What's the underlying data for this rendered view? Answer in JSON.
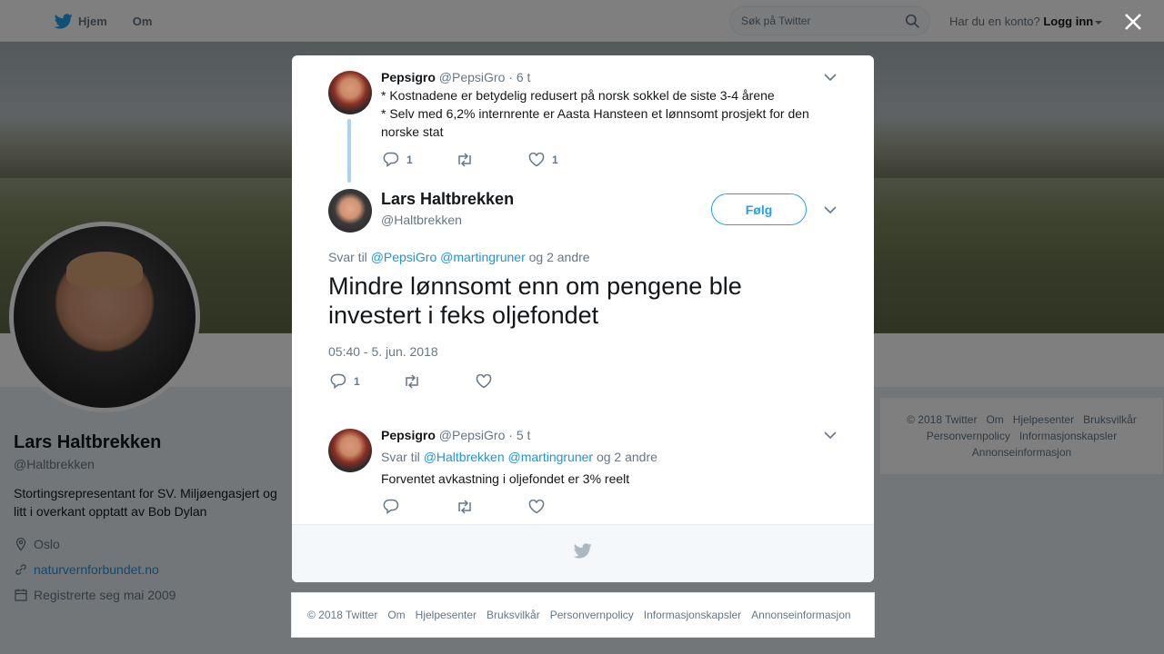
{
  "topbar": {
    "home_label": "Hjem",
    "about_label": "Om",
    "search_placeholder": "Søk på Twitter",
    "account_prompt": "Har du en konto?",
    "login_label": "Logg inn"
  },
  "profile": {
    "name": "Lars Haltbrekken",
    "handle": "@Haltbrekken",
    "bio": "Stortingsrepresentant for SV. Miljøengasjert og litt i overkant opptatt av Bob Dylan",
    "location": "Oslo",
    "website": "naturvernforbundet.no",
    "joined": "Registrerte seg mai 2009"
  },
  "side_footer": [
    "© 2018 Twitter",
    "Om",
    "Hjelpesenter",
    "Bruksvilkår",
    "Personvernpolicy",
    "Informasjonskapsler",
    "Annonseinformasjon"
  ],
  "thread": {
    "parent": {
      "name": "Pepsigro",
      "handle": "@PepsiGro",
      "time": "· 6 t",
      "line1": "* Kostnadene er betydelig redusert på norsk sokkel de siste 3-4 årene",
      "line2": "* Selv med 6,2% internrente er Aasta Hansteen et lønnsomt prosjekt for den norske stat",
      "reply_count": "1",
      "retweet_count": "",
      "like_count": "1"
    },
    "main": {
      "name": "Lars Haltbrekken",
      "handle": "@Haltbrekken",
      "follow_label": "Følg",
      "reply_prefix": "Svar til",
      "mention1": "@PepsiGro",
      "mention2": "@martingruner",
      "reply_suffix": "og 2 andre",
      "text": "Mindre lønnsomt enn om pengene ble investert i feks oljefondet",
      "timestamp": "05:40 - 5. jun. 2018",
      "reply_count": "1"
    },
    "reply": {
      "name": "Pepsigro",
      "handle": "@PepsiGro",
      "time": "· 5 t",
      "reply_prefix": "Svar til",
      "mention1": "@Haltbrekken",
      "mention2": "@martingruner",
      "reply_suffix": "og 2 andre",
      "text": "Forventet avkastning i oljefondet er 3% reelt"
    }
  },
  "bottom_footer": [
    "© 2018 Twitter",
    "Om",
    "Hjelpesenter",
    "Bruksvilkår",
    "Personvernpolicy",
    "Informasjonskapsler",
    "Annonseinformasjon"
  ],
  "colors": {
    "accent": "#1da1f2",
    "link": "#1b95e0",
    "muted": "#657786"
  }
}
